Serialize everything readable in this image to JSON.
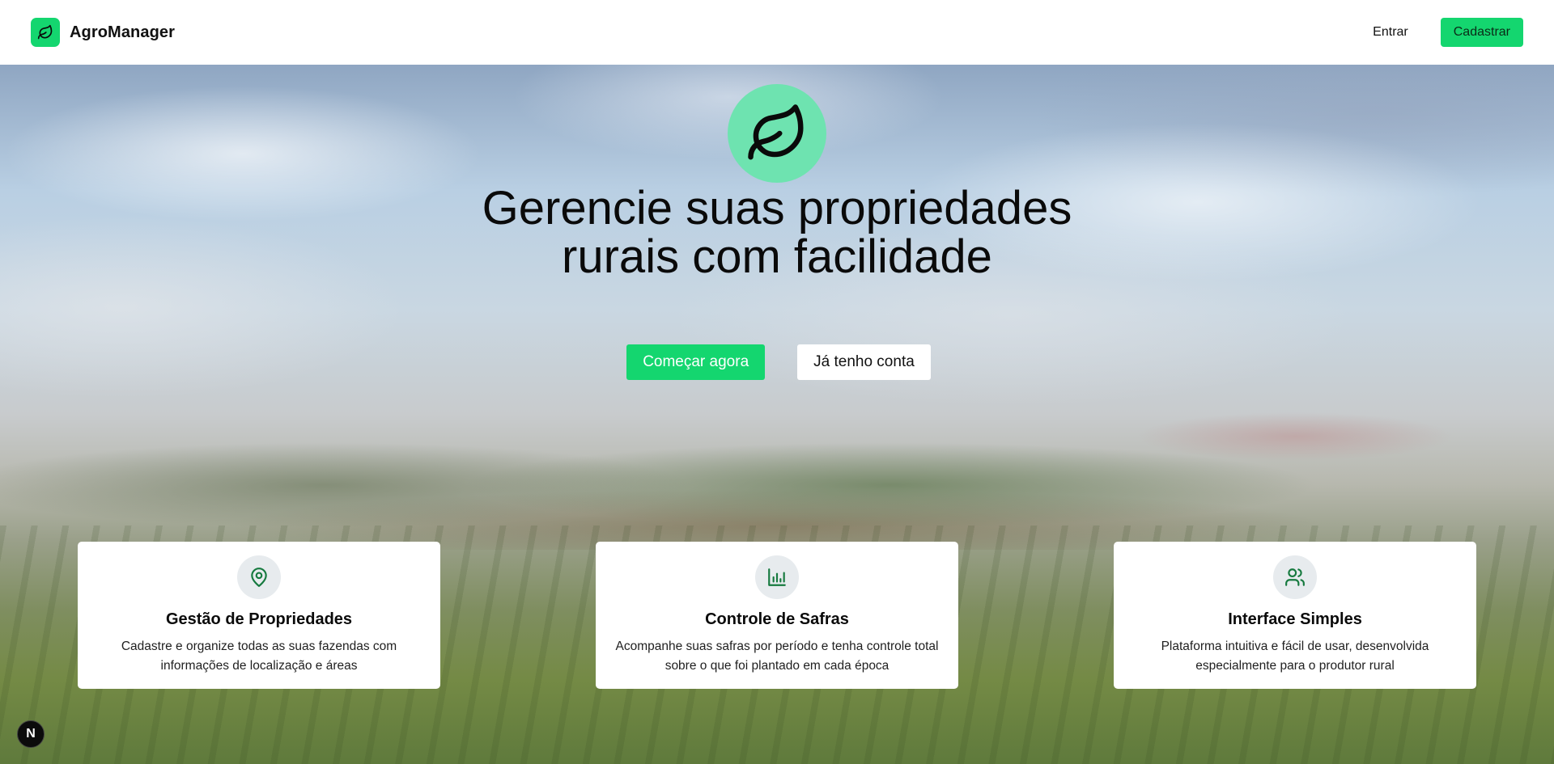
{
  "header": {
    "brand_name": "AgroManager",
    "brand_icon": "leaf-icon",
    "login_label": "Entrar",
    "signup_label": "Cadastrar"
  },
  "hero": {
    "icon": "leaf-icon",
    "title_line1": "Gerencie suas propriedades",
    "title_line2": "rurais com facilidade",
    "primary_cta": "Começar agora",
    "secondary_cta": "Já tenho conta"
  },
  "features": [
    {
      "icon": "map-pin-icon",
      "title": "Gestão de Propriedades",
      "desc_line1": "Cadastre e organize todas as suas fazendas com",
      "desc_line2": "informações de localização e áreas"
    },
    {
      "icon": "bar-chart-icon",
      "title": "Controle de Safras",
      "desc_line1": "Acompanhe suas safras por período e tenha controle total",
      "desc_line2": "sobre o que foi plantado em cada época"
    },
    {
      "icon": "users-icon",
      "title": "Interface Simples",
      "desc_line1": "Plataforma intuitiva e fácil de usar, desenvolvida",
      "desc_line2": "especialmente para o produtor rural"
    }
  ],
  "dev_badge": "N",
  "colors": {
    "accent": "#14d66f",
    "hero_icon_bg": "#6ee3b0",
    "icon_green": "#167a3f"
  }
}
